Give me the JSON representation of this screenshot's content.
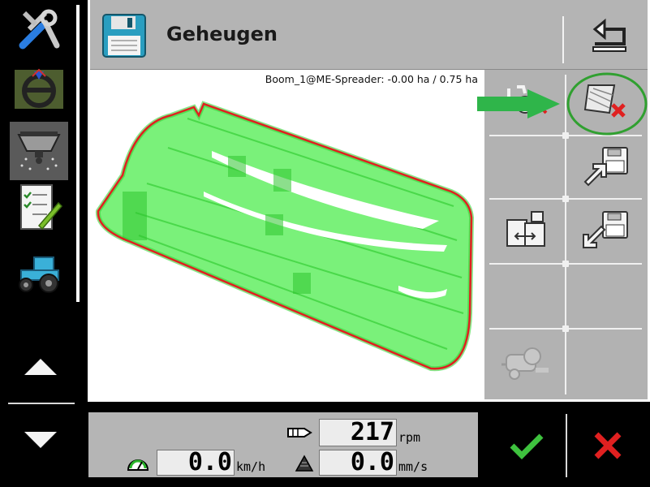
{
  "header": {
    "title": "Geheugen"
  },
  "map": {
    "status": "Boom_1@ME-Spreader: -0.00 ha / 0.75 ha"
  },
  "readouts": {
    "rpm_value": "217",
    "rpm_unit": "rpm",
    "speed_value": "0.0",
    "speed_unit": "km/h",
    "rate_value": "0.0",
    "rate_unit": "mm/s"
  },
  "icons": {
    "sidebar": [
      "tools-icon",
      "steering-wheel-icon",
      "spreader-icon",
      "checklist-icon",
      "tractor-icon"
    ],
    "grid": [
      "delete-coverage-icon",
      "delete-map-icon",
      "save-export-icon",
      "usb-transfer-icon",
      "load-import-icon",
      "baler-icon"
    ]
  },
  "colors": {
    "coverage": "#4dee4d",
    "boundary": "#e02020",
    "accent_arrow": "#2fb54a",
    "highlight_ring": "#30a030",
    "confirm": "#3ec23e",
    "cancel": "#e02020"
  }
}
